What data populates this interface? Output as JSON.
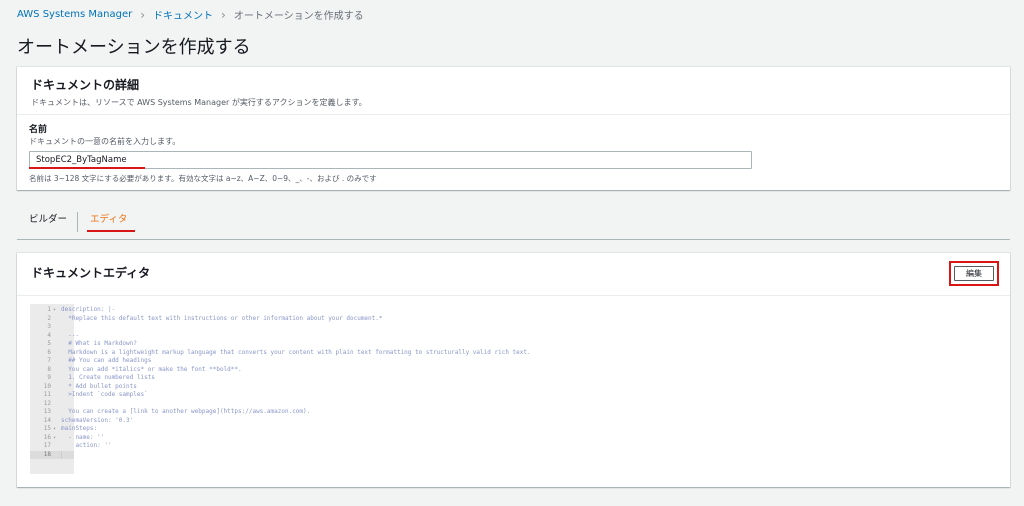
{
  "breadcrumb": {
    "items": [
      "AWS Systems Manager",
      "ドキュメント",
      "オートメーションを作成する"
    ]
  },
  "page_title": "オートメーションを作成する",
  "details": {
    "title": "ドキュメントの詳細",
    "description": "ドキュメントは、リソースで AWS Systems Manager が実行するアクションを定義します。",
    "name_label": "名前",
    "name_sub": "ドキュメントの一意の名前を入力します。",
    "name_value": "StopEC2_ByTagName",
    "name_hint": "名前は 3~128 文字にする必要があります。有効な文字は a~z、A~Z、0~9、_、-、および . のみです"
  },
  "tabs": {
    "builder": "ビルダー",
    "editor": "エディタ",
    "active": "editor"
  },
  "editor": {
    "title": "ドキュメントエディタ",
    "edit_button": "編集",
    "lines": [
      {
        "n": "1",
        "fold": true,
        "text": "description: |-"
      },
      {
        "n": "2",
        "fold": false,
        "text": "  *Replace this default text with instructions or other information about your document.*"
      },
      {
        "n": "3",
        "fold": false,
        "text": ""
      },
      {
        "n": "4",
        "fold": false,
        "text": "  ---"
      },
      {
        "n": "5",
        "fold": false,
        "text": "  # What is Markdown?"
      },
      {
        "n": "6",
        "fold": false,
        "text": "  Markdown is a lightweight markup language that converts your content with plain text formatting to structurally valid rich text."
      },
      {
        "n": "7",
        "fold": false,
        "text": "  ## You can add headings"
      },
      {
        "n": "8",
        "fold": false,
        "text": "  You can add *italics* or make the font **bold**."
      },
      {
        "n": "9",
        "fold": false,
        "text": "  1. Create numbered lists"
      },
      {
        "n": "10",
        "fold": false,
        "text": "  * Add bullet points"
      },
      {
        "n": "11",
        "fold": false,
        "text": "  >Indent `code samples`"
      },
      {
        "n": "12",
        "fold": false,
        "text": ""
      },
      {
        "n": "13",
        "fold": false,
        "text": "  You can create a [link to another webpage](https://aws.amazon.com)."
      },
      {
        "n": "14",
        "fold": false,
        "text": "schemaVersion: '0.3'"
      },
      {
        "n": "15",
        "fold": true,
        "text": "mainSteps:"
      },
      {
        "n": "16",
        "fold": true,
        "text": "  - name: ''"
      },
      {
        "n": "17",
        "fold": false,
        "text": "    action: ''"
      },
      {
        "n": "18",
        "fold": false,
        "text": ""
      }
    ]
  },
  "colors": {
    "link": "#0073bb",
    "active_tab": "#ec7211",
    "highlight": "#d91515",
    "code_text": "#8a97c9"
  }
}
